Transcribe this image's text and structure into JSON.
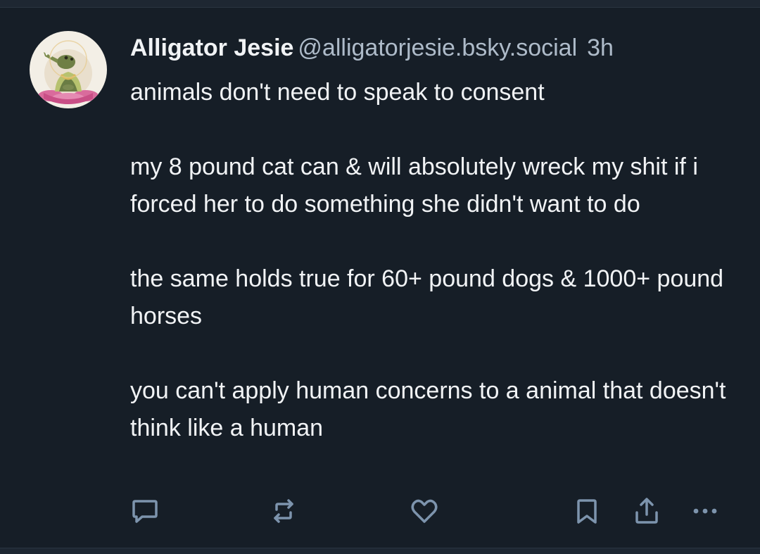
{
  "post": {
    "author": {
      "display_name": "Alligator Jesie",
      "handle": "@alligatorjesie.bsky.social",
      "avatar_icon": "alligator-meditating-on-lotus"
    },
    "time": "3h",
    "paragraphs": [
      "animals don't need to speak to consent",
      "my 8 pound cat can & will absolutely wreck my shit if i forced her to do something she didn't want to do",
      "the same holds true for 60+ pound dogs & 1000+ pound horses",
      "you can't apply human concerns to a animal that doesn't think like a human"
    ],
    "actions": [
      {
        "name": "reply",
        "icon": "speech-bubble-icon"
      },
      {
        "name": "repost",
        "icon": "repost-arrows-icon"
      },
      {
        "name": "like",
        "icon": "heart-outline-icon"
      },
      {
        "name": "bookmark",
        "icon": "bookmark-icon"
      },
      {
        "name": "share",
        "icon": "share-upload-icon"
      },
      {
        "name": "more",
        "icon": "ellipsis-icon"
      }
    ]
  },
  "colors": {
    "background": "#161e27",
    "text_primary": "#f1f3f5",
    "text_secondary": "#aebbc9",
    "icon": "#7d94ad"
  }
}
